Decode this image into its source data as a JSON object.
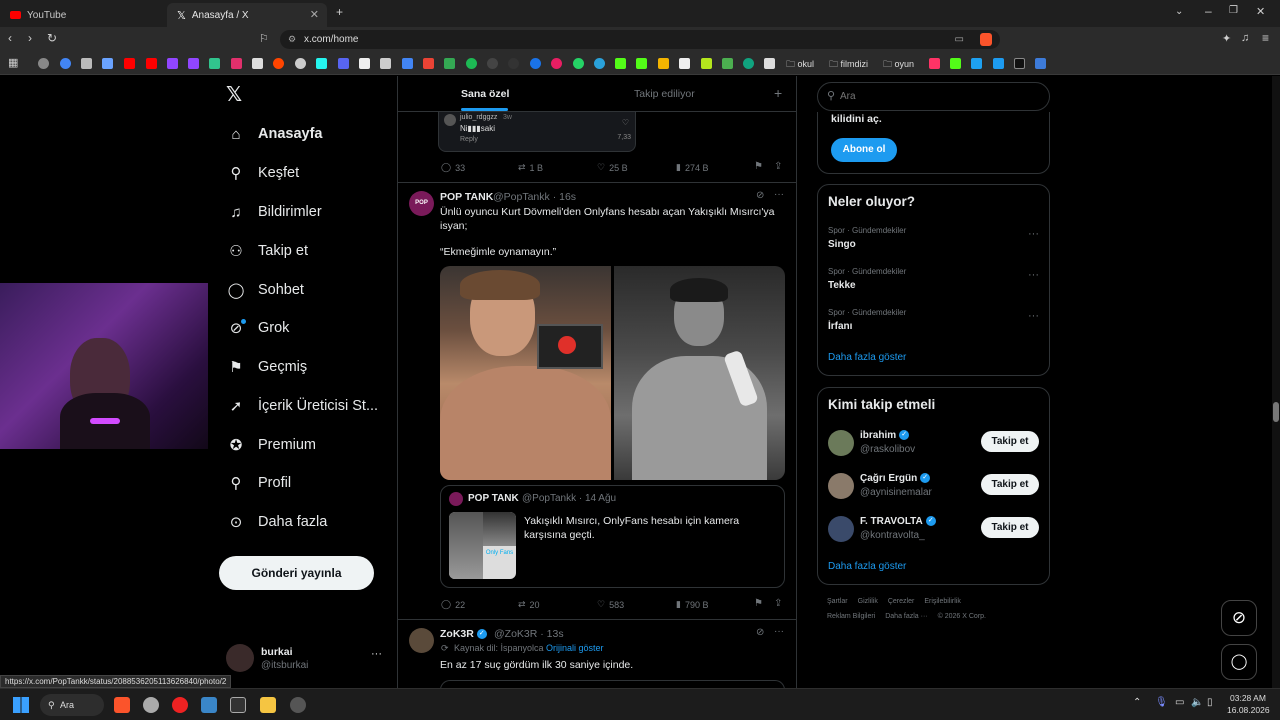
{
  "browser": {
    "tabs": [
      {
        "title": "YouTube",
        "active": false
      },
      {
        "title": "Anasayfa / X",
        "active": true
      }
    ],
    "url": "x.com/home",
    "bookmark_folders": [
      "okul",
      "filmdizi",
      "oyun"
    ],
    "status_url": "https://x.com/PopTankk/status/2088536205113626840/photo/2"
  },
  "sidebar": {
    "items": [
      {
        "label": "Anasayfa",
        "icon": "home-icon"
      },
      {
        "label": "Keşfet",
        "icon": "search-icon"
      },
      {
        "label": "Bildirimler",
        "icon": "bell-icon"
      },
      {
        "label": "Takip et",
        "icon": "add-person-icon"
      },
      {
        "label": "Sohbet",
        "icon": "chat-icon"
      },
      {
        "label": "Grok",
        "icon": "grok-icon"
      },
      {
        "label": "Geçmiş",
        "icon": "bookmark-icon"
      },
      {
        "label": "İçerik Üreticisi St...",
        "icon": "rocket-icon"
      },
      {
        "label": "Premium",
        "icon": "verified-icon"
      },
      {
        "label": "Profil",
        "icon": "person-icon"
      },
      {
        "label": "Daha fazla",
        "icon": "more-circle-icon"
      }
    ],
    "post_button": "Gönderi yayınla",
    "user": {
      "name": "burkai",
      "handle": "@itsburkai"
    }
  },
  "feed": {
    "tabs": [
      "Sana özel",
      "Takip ediliyor"
    ],
    "prev_tweet": {
      "reply_user": "julio_rdggzz",
      "reply_time": "3w",
      "reply_text": "Ni▮▮▮saki",
      "reply_label": "Reply",
      "reply_count": "7,33",
      "stats": {
        "replies": "33",
        "retweets": "1 B",
        "likes": "25 B",
        "views": "274 B"
      }
    },
    "tweet1": {
      "name": "POP TANK",
      "handle": "@PopTankk · 16s",
      "text1": "Ünlü oyuncu Kurt Dövmeli'den Onlyfans hesabı açan Yakışıklı Mısırcı'ya isyan;",
      "text2": "“Ekmeğimle oynamayın.”",
      "quote": {
        "name": "POP TANK",
        "handle": "@PopTankk · 14 Ağu",
        "text": "Yakışıklı Mısırcı, OnlyFans hesabı için kamera karşısına geçti.",
        "thumb_label": "Only Fans"
      },
      "stats": {
        "replies": "22",
        "retweets": "20",
        "likes": "583",
        "views": "790 B"
      }
    },
    "tweet2": {
      "name": "ZoK3R",
      "handle": "@ZoK3R · 13s",
      "source_label": "Kaynak dil: İspanyolca",
      "source_link": "Orijinali göster",
      "text": "En az 17 suç gördüm ilk 30 saniye içinde."
    }
  },
  "right": {
    "search_placeholder": "Ara",
    "premium": {
      "text": "kilidini aç.",
      "button": "Abone ol"
    },
    "trends": {
      "title": "Neler oluyor?",
      "items": [
        {
          "category": "Spor · Gündemdekiler",
          "name": "Singo"
        },
        {
          "category": "Spor · Gündemdekiler",
          "name": "Tekke"
        },
        {
          "category": "Spor · Gündemdekiler",
          "name": "İrfanı"
        }
      ],
      "more": "Daha fazla göster"
    },
    "who_to_follow": {
      "title": "Kimi takip etmeli",
      "users": [
        {
          "name": "ibrahim",
          "handle": "@raskolibov"
        },
        {
          "name": "Çağrı Ergün",
          "handle": "@aynisinemalar"
        },
        {
          "name": "F. TRAVOLTA",
          "handle": "@kontravolta_"
        }
      ],
      "button": "Takip et",
      "more": "Daha fazla göster"
    },
    "footer": {
      "line1": [
        "Şartlar",
        "Gizlilik",
        "Çerezler",
        "Erişilebilirlik"
      ],
      "line2": [
        "Reklam Bilgileri",
        "Daha fazla ···",
        "© 2026 X Corp."
      ]
    }
  },
  "taskbar": {
    "search": "Ara",
    "time": "03:28 AM",
    "date": "16.08.2026"
  },
  "colors": {
    "accent": "#1d9bf0",
    "like": "#f91880"
  }
}
